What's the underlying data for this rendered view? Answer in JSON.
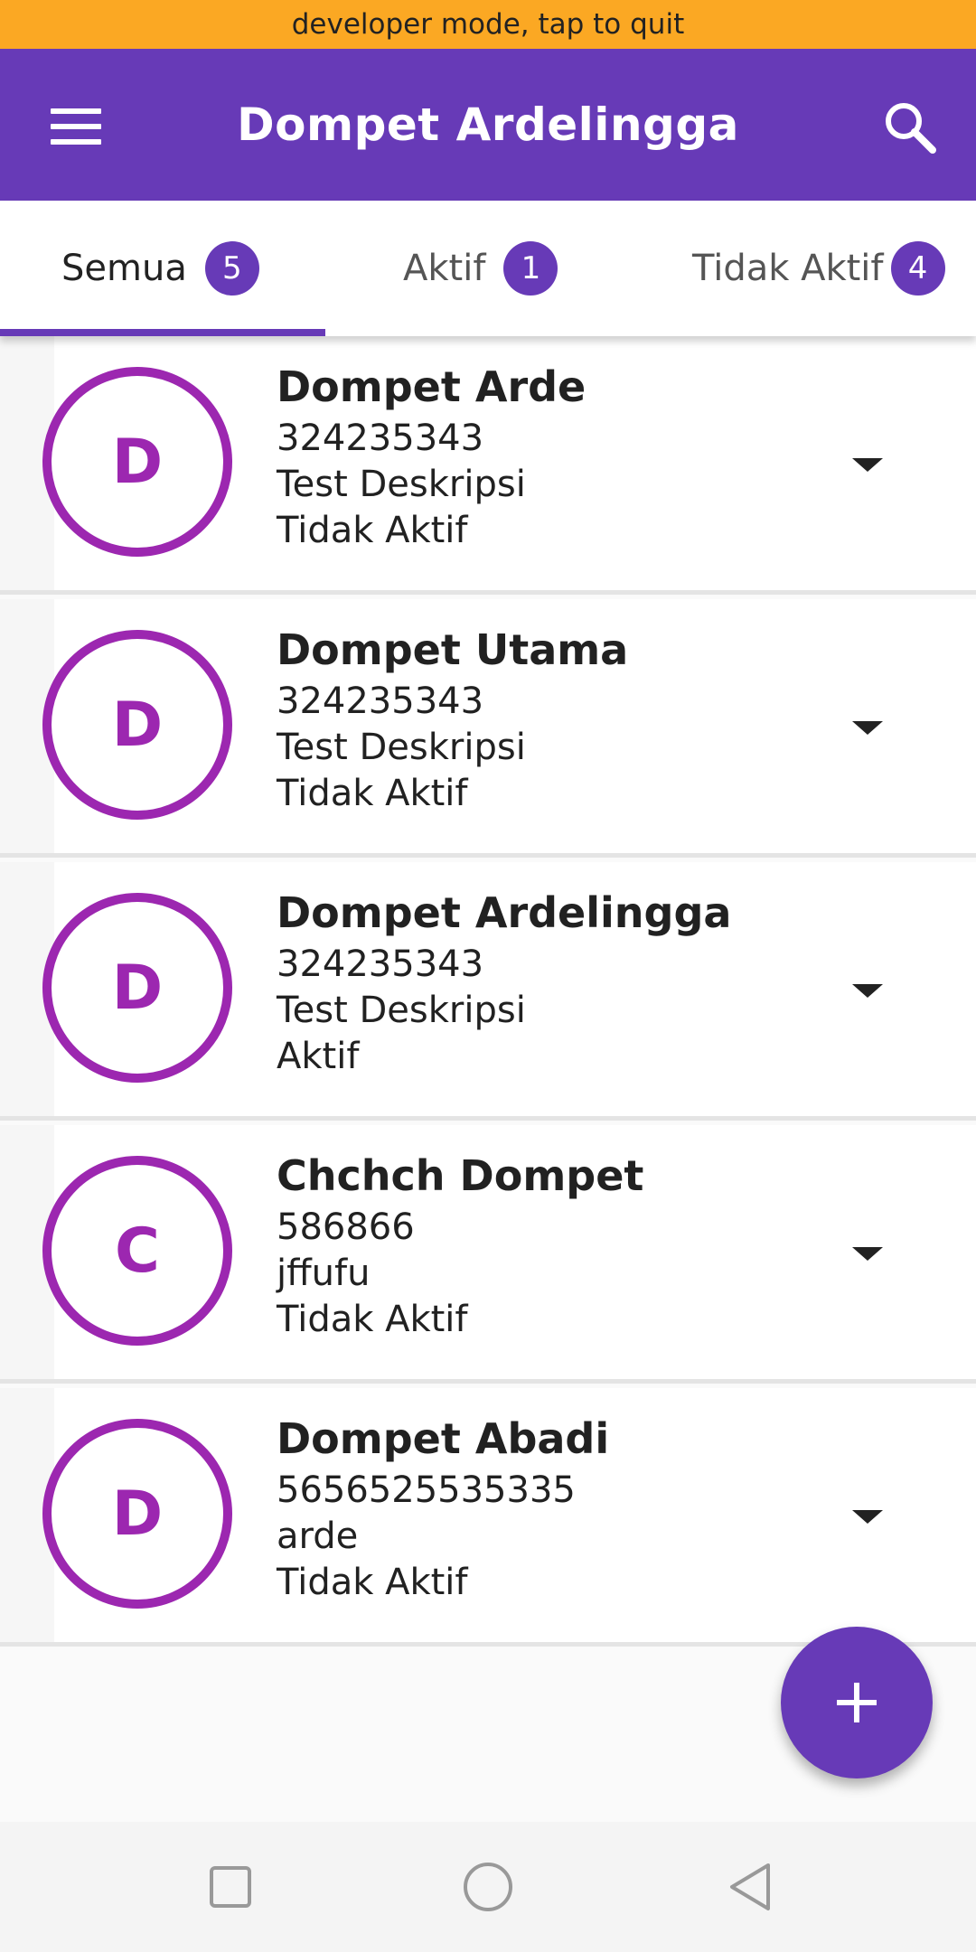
{
  "status_banner": "developer mode, tap to quit",
  "appbar": {
    "title": "Dompet Ardelingga",
    "menu_icon": "hamburger-menu-icon",
    "search_icon": "search-icon",
    "color": "#673AB7"
  },
  "tabs": [
    {
      "label": "Semua",
      "count": "5",
      "active": true
    },
    {
      "label": "Aktif",
      "count": "1",
      "active": false
    },
    {
      "label": "Tidak Aktif",
      "count": "4",
      "active": false
    }
  ],
  "wallets": [
    {
      "initial": "D",
      "name": "Dompet Arde",
      "number": "324235343",
      "description": "Test Deskripsi",
      "status": "Tidak  Aktif"
    },
    {
      "initial": "D",
      "name": "Dompet Utama",
      "number": "324235343",
      "description": "Test Deskripsi",
      "status": "Tidak  Aktif"
    },
    {
      "initial": "D",
      "name": "Dompet Ardelingga",
      "number": "324235343",
      "description": "Test Deskripsi",
      "status": "Aktif"
    },
    {
      "initial": "C",
      "name": "Chchch Dompet",
      "number": "586866",
      "description": "jffufu",
      "status": "Tidak  Aktif"
    },
    {
      "initial": "D",
      "name": "Dompet Abadi",
      "number": "5656525535335",
      "description": "arde",
      "status": "Tidak  Aktif"
    }
  ],
  "fab": {
    "icon": "plus-icon"
  },
  "system_nav": {
    "recents_icon": "square-recents-icon",
    "home_icon": "circle-home-icon",
    "back_icon": "triangle-back-icon"
  },
  "colors": {
    "banner": "#FBA823",
    "accent": "#673AB7",
    "avatar": "#9C27B0"
  }
}
